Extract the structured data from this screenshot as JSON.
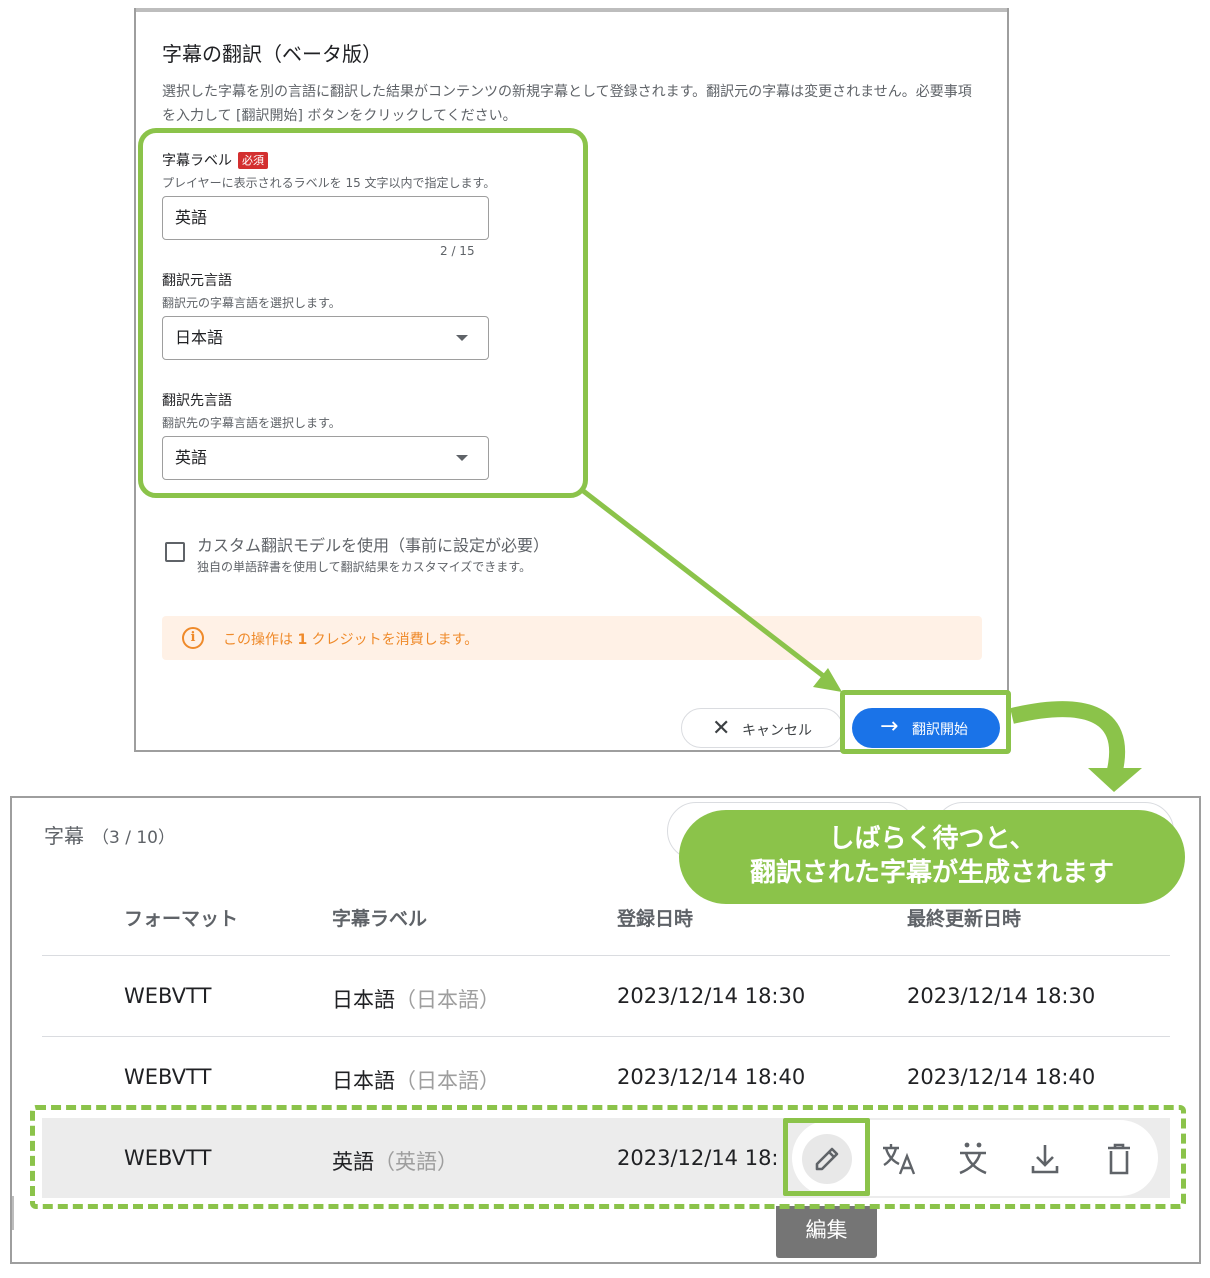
{
  "dialog": {
    "title": "字幕の翻訳（ベータ版）",
    "description": "選択した字幕を別の言語に翻訳した結果がコンテンツの新規字幕として登録されます。翻訳元の字幕は変更されません。必要事項を入力して [翻訳開始] ボタンをクリックしてください。",
    "label_field": {
      "label": "字幕ラベル",
      "required_badge": "必須",
      "help": "プレイヤーに表示されるラベルを 15 文字以内で指定します。",
      "value": "英語",
      "counter": "2 / 15"
    },
    "source_language": {
      "label": "翻訳元言語",
      "help": "翻訳元の字幕言語を選択します。",
      "value": "日本語"
    },
    "target_language": {
      "label": "翻訳先言語",
      "help": "翻訳先の字幕言語を選択します。",
      "value": "英語"
    },
    "custom_model": {
      "label": "カスタム翻訳モデルを使用（事前に設定が必要）",
      "help": "独自の単語辞書を使用して翻訳結果をカスタマイズできます。",
      "checked": false
    },
    "alert": {
      "prefix": "この操作は ",
      "credits": "1",
      "suffix": " クレジットを消費します。",
      "icon": "info-icon"
    },
    "cancel_label": "キャンセル",
    "start_label": "翻訳開始"
  },
  "subtitles": {
    "title": "字幕",
    "count": "（3 / 10）",
    "columns": [
      "フォーマット",
      "字幕ラベル",
      "登録日時",
      "最終更新日時"
    ],
    "rows": [
      {
        "format": "WEBVTT",
        "label": "日本語",
        "label_sub": "（日本語）",
        "created": "2023/12/14 18:30",
        "updated": "2023/12/14 18:30"
      },
      {
        "format": "WEBVTT",
        "label": "日本語",
        "label_sub": "（日本語）",
        "created": "2023/12/14 18:40",
        "updated": "2023/12/14 18:40"
      },
      {
        "format": "WEBVTT",
        "label": "英語",
        "label_sub": "（英語）",
        "created": "2023/12/14 18:",
        "updated": ""
      }
    ],
    "actions": [
      "edit-icon",
      "translate-icon",
      "subtitle-language-icon",
      "download-icon",
      "delete-icon"
    ],
    "tooltip": "編集"
  },
  "callout": {
    "line1": "しばらく待つと、",
    "line2": "翻訳された字幕が生成されます"
  },
  "colors": {
    "annotation_green": "#8bc34a",
    "primary_blue": "#1a73e8",
    "required_red": "#d32f2f",
    "alert_orange": "#ef8a2a",
    "alert_bg": "#fff1e6"
  }
}
